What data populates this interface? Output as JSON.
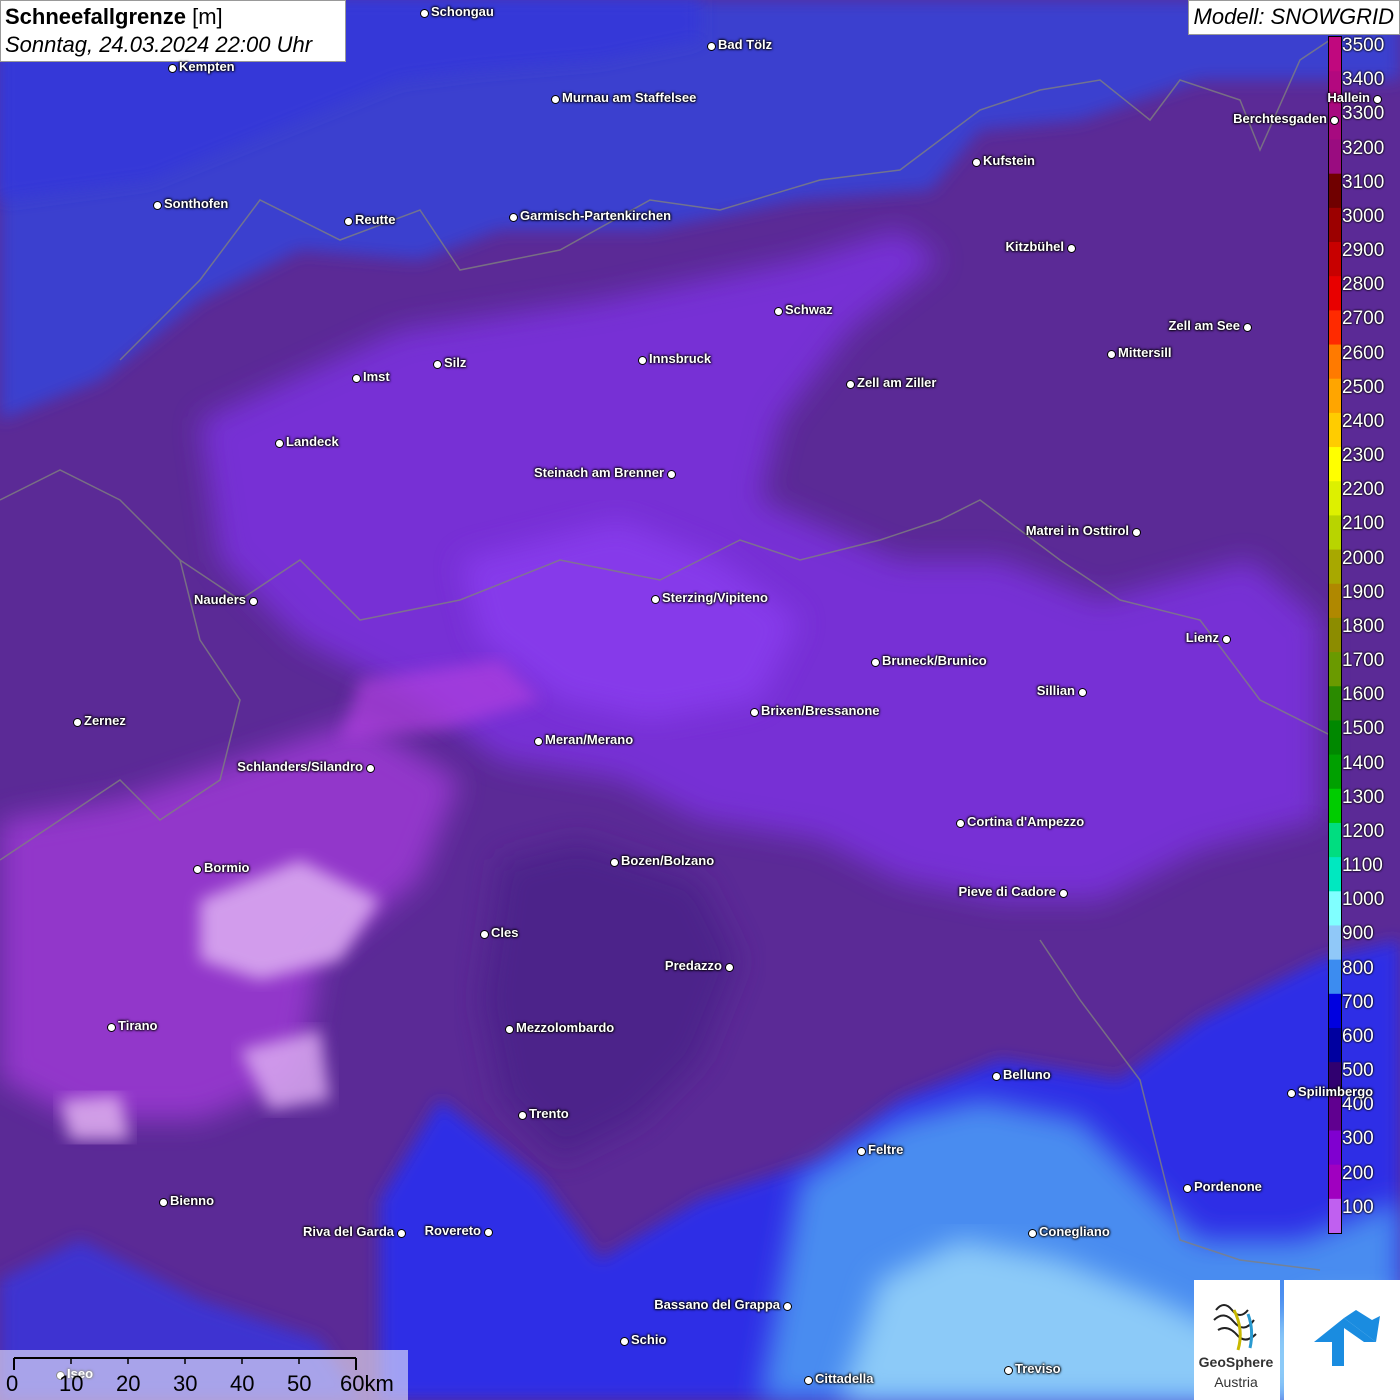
{
  "title": {
    "main": "Schneefallgrenze",
    "unit": "[m]",
    "datetime": "Sonntag, 24.03.2024 22:00 Uhr"
  },
  "model": {
    "label": "Modell: SNOWGRID"
  },
  "legend": {
    "ticks": [
      "3500",
      "3400",
      "3300",
      "3200",
      "3100",
      "3000",
      "2900",
      "2800",
      "2700",
      "2600",
      "2500",
      "2400",
      "2300",
      "2200",
      "2100",
      "2000",
      "1900",
      "1800",
      "1700",
      "1600",
      "1500",
      "1400",
      "1300",
      "1200",
      "1100",
      "1000",
      "900",
      "800",
      "700",
      "600",
      "500",
      "400",
      "300",
      "200",
      "100"
    ],
    "colors": [
      "#c0087e",
      "#b3087f",
      "#a70a80",
      "#9a0c80",
      "#700000",
      "#9c0000",
      "#c80000",
      "#e80000",
      "#ff2a00",
      "#ff7a00",
      "#ffa500",
      "#ffcc00",
      "#ffff00",
      "#ddf000",
      "#b8d400",
      "#a8a800",
      "#b08800",
      "#8c8c00",
      "#6a9a00",
      "#2a8a00",
      "#008800",
      "#00a000",
      "#00cc00",
      "#00dd80",
      "#00e8c0",
      "#80ffff",
      "#90c8f8",
      "#3c8cf0",
      "#0000e0",
      "#0000a0",
      "#300070",
      "#600090",
      "#8000d0",
      "#a000c0",
      "#c060f0"
    ]
  },
  "cities": [
    {
      "name": "Schongau",
      "side": "right"
    },
    {
      "name": "Bad Tölz",
      "side": "right"
    },
    {
      "name": "Kempten",
      "side": "right"
    },
    {
      "name": "Murnau am Staffelsee",
      "side": "right"
    },
    {
      "name": "Hallein",
      "side": "left"
    },
    {
      "name": "Berchtesgaden",
      "side": "left"
    },
    {
      "name": "Kufstein",
      "side": "right"
    },
    {
      "name": "Sonthofen",
      "side": "right"
    },
    {
      "name": "Reutte",
      "side": "right"
    },
    {
      "name": "Garmisch-Partenkirchen",
      "side": "right"
    },
    {
      "name": "Kitzbühel",
      "side": "left"
    },
    {
      "name": "Schwaz",
      "side": "right"
    },
    {
      "name": "Zell am See",
      "side": "left"
    },
    {
      "name": "Innsbruck",
      "side": "right"
    },
    {
      "name": "Mittersill",
      "side": "right"
    },
    {
      "name": "Silz",
      "side": "right"
    },
    {
      "name": "Imst",
      "side": "right"
    },
    {
      "name": "Zell am Ziller",
      "side": "right"
    },
    {
      "name": "Landeck",
      "side": "right"
    },
    {
      "name": "Steinach am Brenner",
      "side": "left"
    },
    {
      "name": "Matrei in Osttirol",
      "side": "left"
    },
    {
      "name": "Nauders",
      "side": "left"
    },
    {
      "name": "Sterzing/Vipiteno",
      "side": "right"
    },
    {
      "name": "Lienz",
      "side": "left"
    },
    {
      "name": "Bruneck/Brunico",
      "side": "right"
    },
    {
      "name": "Sillian",
      "side": "left"
    },
    {
      "name": "Brixen/Bressanone",
      "side": "right"
    },
    {
      "name": "Zernez",
      "side": "right"
    },
    {
      "name": "Meran/Merano",
      "side": "right"
    },
    {
      "name": "Schlanders/Silandro",
      "side": "left"
    },
    {
      "name": "Cortina d'Ampezzo",
      "side": "right"
    },
    {
      "name": "Bozen/Bolzano",
      "side": "right"
    },
    {
      "name": "Bormio",
      "side": "right"
    },
    {
      "name": "Pieve di Cadore",
      "side": "left"
    },
    {
      "name": "Cles",
      "side": "right"
    },
    {
      "name": "Predazzo",
      "side": "left"
    },
    {
      "name": "Tirano",
      "side": "right"
    },
    {
      "name": "Mezzolombardo",
      "side": "right"
    },
    {
      "name": "Belluno",
      "side": "right"
    },
    {
      "name": "Spilimbergo",
      "side": "right"
    },
    {
      "name": "Trento",
      "side": "right"
    },
    {
      "name": "Feltre",
      "side": "right"
    },
    {
      "name": "Pordenone",
      "side": "right"
    },
    {
      "name": "Bienno",
      "side": "right"
    },
    {
      "name": "Riva del Garda",
      "side": "left"
    },
    {
      "name": "Rovereto",
      "side": "left"
    },
    {
      "name": "Conegliano",
      "side": "right"
    },
    {
      "name": "Bassano del Grappa",
      "side": "left"
    },
    {
      "name": "Schio",
      "side": "right"
    },
    {
      "name": "Treviso",
      "side": "right"
    },
    {
      "name": "Cittadella",
      "side": "right"
    },
    {
      "name": "Iseo",
      "side": "right"
    }
  ],
  "scale": {
    "labels": [
      "0",
      "10",
      "20",
      "30",
      "40",
      "50",
      "60km"
    ]
  },
  "logos": {
    "geosphere_line1": "GeoSphere",
    "geosphere_line2": "Austria"
  }
}
